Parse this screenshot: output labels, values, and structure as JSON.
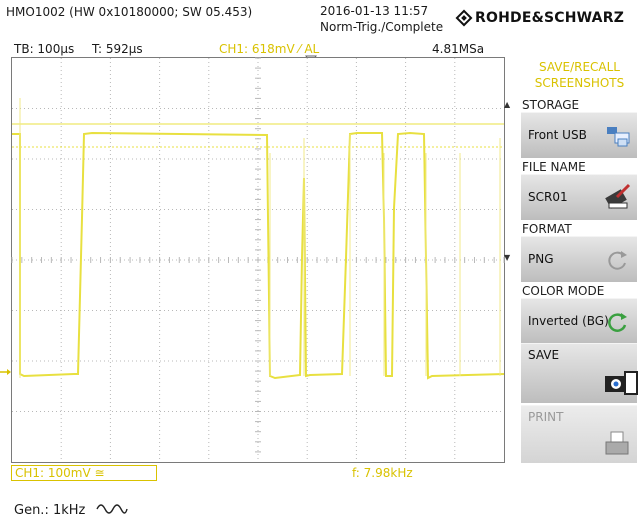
{
  "header": {
    "model": "HMO1002 (HW 0x10180000; SW 05.453)",
    "datetime": "2016-01-13 11:57",
    "trigger_status": "Norm-Trig./Complete",
    "brand": "ROHDE&SCHWARZ"
  },
  "status_bar": {
    "timebase": "TB: 100µs",
    "trigger_time": "T: 592µs",
    "channel_info": "CH1: 618mV ⁄ AL",
    "sample_rate": "4.81MSa"
  },
  "menu": {
    "title_line1": "SAVE/RECALL",
    "title_line2": "SCREENSHOTS",
    "storage_label": "STORAGE",
    "storage_value": "Front USB",
    "file_name_label": "FILE NAME",
    "file_name_value": "SCR01",
    "format_label": "FORMAT",
    "format_value": "PNG",
    "color_mode_label": "COLOR MODE",
    "color_mode_value": "Inverted (BG)",
    "save_label": "SAVE",
    "print_label": "PRINT"
  },
  "footer": {
    "ch1_scale": "CH1: 100mV ≅",
    "frequency": "f: 7.98kHz",
    "generator": "Gen.: 1kHz"
  },
  "colors": {
    "trace": "#e8e040",
    "accent": "#d9c200",
    "grid": "#b8b8b8"
  },
  "icons": {
    "storage": "usb-folder-icon",
    "file_name": "edit-file-icon",
    "format": "cycle-icon",
    "color_mode": "cycle-icon",
    "save": "camera-save-icon",
    "print": "printer-icon",
    "generator": "sine-wave-icon",
    "ground_marker": "ground-marker-icon",
    "trigger_marker": "trigger-marker-icon"
  }
}
